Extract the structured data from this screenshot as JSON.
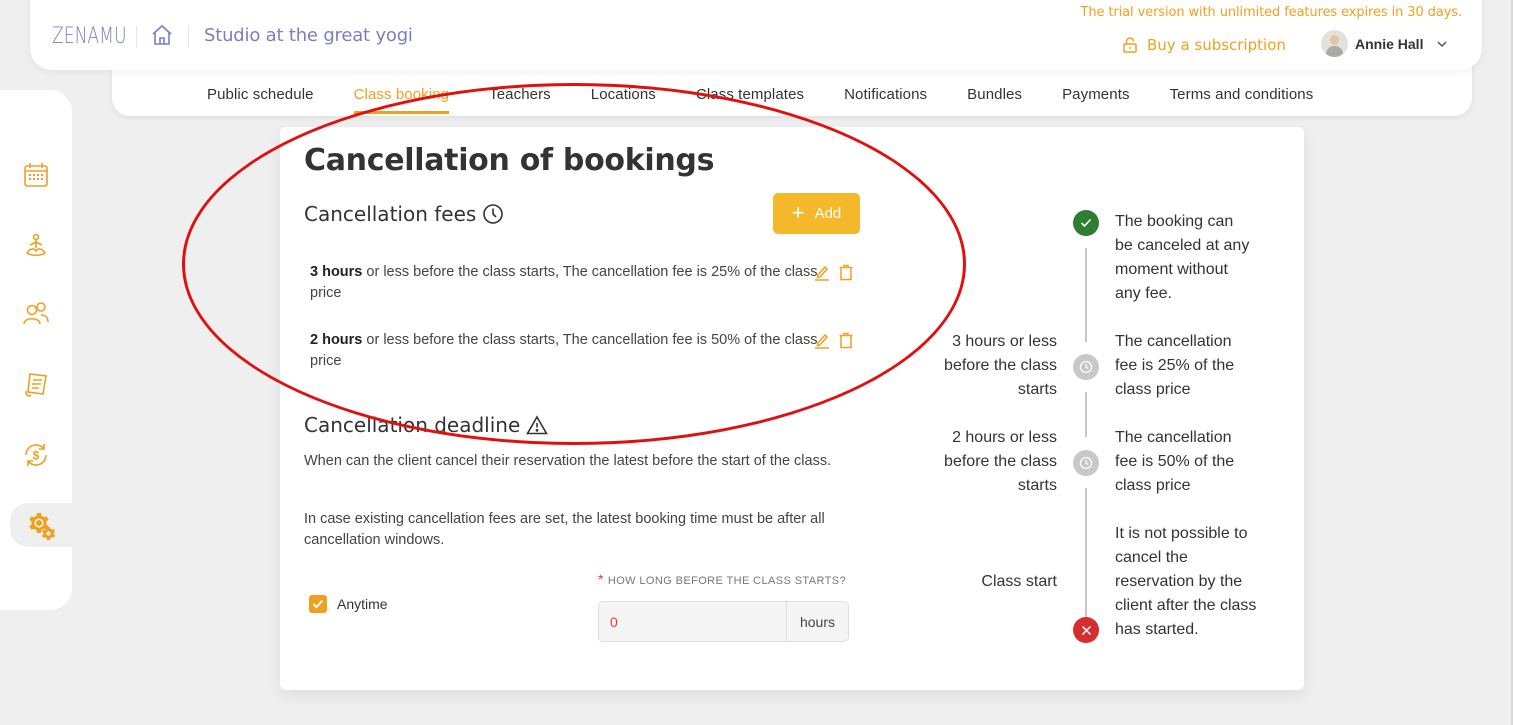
{
  "header": {
    "brand": "ZENAMU",
    "home_icon": "home-icon",
    "studio_name": "Studio at the great yogi",
    "trial_notice": "The trial version with unlimited features expires in 30 days.",
    "buy_subscription": "Buy a subscription",
    "buy_icon": "unlock-icon",
    "user_name": "Annie Hall",
    "user_menu_icon": "chevron-down-icon"
  },
  "tabs": [
    {
      "label": "Public schedule",
      "active": false
    },
    {
      "label": "Class booking",
      "active": true
    },
    {
      "label": "Teachers",
      "active": false
    },
    {
      "label": "Locations",
      "active": false
    },
    {
      "label": "Class templates",
      "active": false
    },
    {
      "label": "Notifications",
      "active": false
    },
    {
      "label": "Bundles",
      "active": false
    },
    {
      "label": "Payments",
      "active": false
    },
    {
      "label": "Terms and conditions",
      "active": false
    }
  ],
  "sidebar": {
    "items": [
      {
        "icon": "calendar-icon",
        "active": false
      },
      {
        "icon": "yoga-icon",
        "active": false
      },
      {
        "icon": "users-icon",
        "active": false
      },
      {
        "icon": "receipt-icon",
        "active": false
      },
      {
        "icon": "money-cycle-icon",
        "active": false
      },
      {
        "icon": "settings-gears-icon",
        "active": true
      }
    ]
  },
  "main": {
    "title": "Cancellation of bookings",
    "fees": {
      "title": "Cancellation fees",
      "add_label": "Add",
      "items": [
        {
          "hours": "3 hours",
          "text": " or less before the class starts, The cancellation fee is 25% of the class price"
        },
        {
          "hours": "2 hours",
          "text": " or less before the class starts, The cancellation fee is 50% of the class price"
        }
      ]
    },
    "deadline": {
      "title": "Cancellation deadline",
      "desc1": "When can the client cancel their reservation the latest before the start of the class.",
      "desc2": "In case existing cancellation fees are set, the latest booking time must be after all cancellation windows.",
      "anytime_label": "Anytime",
      "anytime_checked": true,
      "field_required": "*",
      "field_label": "HOW LONG BEFORE THE CLASS STARTS?",
      "field_value": "0",
      "field_unit": "hours"
    },
    "timeline": [
      {
        "left": "",
        "right": "The booking can be canceled at any moment without any fee.",
        "status": "ok"
      },
      {
        "left": "3 hours or less before the class starts",
        "right": "The cancellation fee is 25% of the class price",
        "status": "fee"
      },
      {
        "left": "2 hours or less before the class starts",
        "right": "The cancellation fee is 50% of the class price",
        "status": "fee"
      },
      {
        "left": "Class start",
        "right": "It is not possible to cancel the reservation by the client after the class has started.",
        "status": "blocked"
      }
    ]
  },
  "colors": {
    "accent": "#f0a020",
    "brand": "#7b7fbf",
    "button": "#f6b82b",
    "ok": "#2e7d32",
    "blocked": "#d32f2f",
    "annotation": "#e01010"
  }
}
